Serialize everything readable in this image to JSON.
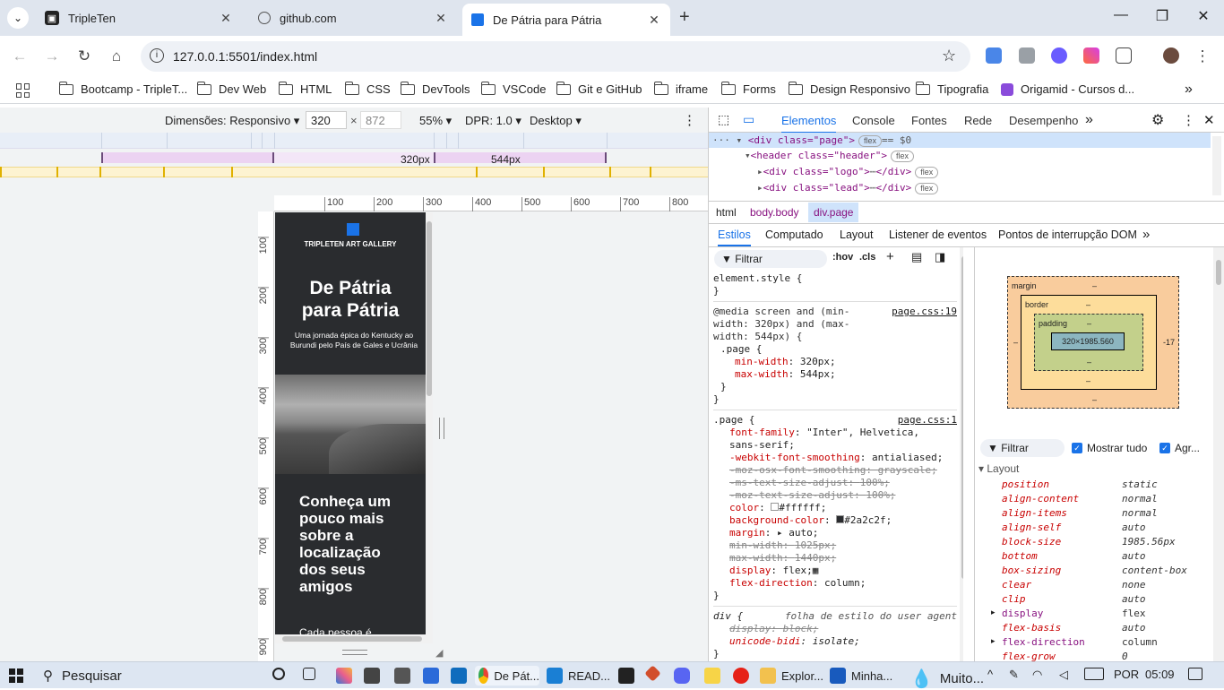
{
  "tabs": [
    {
      "title": "TripleTen",
      "icon": "tripleten-icon"
    },
    {
      "title": "github.com",
      "icon": "globe-icon"
    },
    {
      "title": "De Pátria para Pátria",
      "icon": "page-icon"
    }
  ],
  "address": {
    "url": "127.0.0.1:5501/index.html"
  },
  "bookmarks": [
    "Bootcamp - TripleT...",
    "Dev Web",
    "HTML",
    "CSS",
    "DevTools",
    "VSCode",
    "Git e GitHub",
    "iframe",
    "Forms",
    "Design Responsivo",
    "Tipografia",
    "Origamid - Cursos d..."
  ],
  "device_toolbar": {
    "dimensions": "Dimensões: Responsivo",
    "width": "320",
    "height": "872",
    "zoom": "55%",
    "dpr": "DPR: 1.0",
    "device": "Desktop",
    "x": "×"
  },
  "media_queries": {
    "a": "320px",
    "b": "544px"
  },
  "ruler": {
    "top": [
      "100",
      "200",
      "300",
      "400",
      "500",
      "600",
      "700",
      "800"
    ],
    "left": [
      "100",
      "200",
      "300",
      "400",
      "500",
      "600",
      "700",
      "800",
      "900"
    ]
  },
  "site": {
    "brand": "TRIPLETEN ART GALLERY",
    "title": "De Pátria para Pátria",
    "lead": "Uma jornada épica do Kentucky ao Burundi pelo País de Gales e Ucrânia",
    "section_title": "Conheça um pouco mais sobre a localização dos seus amigos",
    "body_start": "Cada pessoa é"
  },
  "devtools": {
    "tabs": [
      "Elementos",
      "Console",
      "Fontes",
      "Rede",
      "Desempenho"
    ],
    "dom": {
      "line1_tag": "<div class=\"page\">",
      "line1_badge": "flex",
      "line1_eq": "== $0",
      "line2_tag": "<header class=\"header\">",
      "line2_badge": "flex",
      "line3_tag": "<div class=\"logo\">",
      "line3_end": "</div>",
      "line3_badge": "flex",
      "line4_tag": "<div class=\"lead\">",
      "line4_end": "</div>",
      "line4_badge": "flex"
    },
    "breadcrumb": [
      "html",
      "body.body",
      "div.page"
    ],
    "subtabs": [
      "Estilos",
      "Computado",
      "Layout",
      "Listener de eventos",
      "Pontos de interrupção DOM"
    ],
    "filter": "Filtrar",
    "hov": ":hov",
    "cls": ".cls",
    "styles": {
      "element_style": "element.style {",
      "close": "}",
      "media": "@media screen and (min-width: 320px) and (max-width: 544px) {",
      "media_link": "page.css:19",
      "rule1_sel": ".page {",
      "rule1": [
        [
          "min-width",
          "320px;"
        ],
        [
          "max-width",
          "544px;"
        ]
      ],
      "rule2_sel": ".page {",
      "rule2_link": "page.css:1",
      "rule2": [
        [
          "font-family",
          "\"Inter\", Helvetica, sans-serif;"
        ],
        [
          "-webkit-font-smoothing",
          "antialiased;"
        ],
        [
          "-moz-osx-font-smoothing",
          "grayscale;"
        ],
        [
          "-ms-text-size-adjust",
          "100%;"
        ],
        [
          "-moz-text-size-adjust",
          "100%;"
        ],
        [
          "color",
          "#ffffff;"
        ],
        [
          "background-color",
          "#2a2c2f;"
        ],
        [
          "margin",
          "auto;"
        ],
        [
          "min-width",
          "1025px;"
        ],
        [
          "max-width",
          "1440px;"
        ],
        [
          "display",
          "flex;"
        ],
        [
          "flex-direction",
          "column;"
        ]
      ],
      "ua_sel": "div {",
      "ua_note": "folha de estilo do user agent",
      "ua": [
        [
          "display",
          "block;"
        ],
        [
          "unicode-bidi",
          "isolate;"
        ]
      ]
    },
    "boxmodel": {
      "margin": "margin",
      "border": "border",
      "padding": "padding",
      "content": "320×1985.560",
      "dash": "–",
      "right": "-17"
    },
    "computed_filter": "Filtrar",
    "show_all": "Mostrar tudo",
    "group": "Agr...",
    "layout_header": "Layout",
    "computed": [
      [
        "position",
        "static"
      ],
      [
        "align-content",
        "normal"
      ],
      [
        "align-items",
        "normal"
      ],
      [
        "align-self",
        "auto"
      ],
      [
        "block-size",
        "1985.56px"
      ],
      [
        "bottom",
        "auto"
      ],
      [
        "box-sizing",
        "content-box"
      ],
      [
        "clear",
        "none"
      ],
      [
        "clip",
        "auto"
      ],
      [
        "display",
        "flex"
      ],
      [
        "flex-basis",
        "auto"
      ],
      [
        "flex-direction",
        "column"
      ],
      [
        "flex-grow",
        "0"
      ]
    ]
  },
  "taskbar": {
    "search": "Pesquisar",
    "apps": [
      "De Pát...",
      "READ...",
      "Explor...",
      "Minha..."
    ],
    "weather": "Muito...",
    "lang": "POR",
    "time": "05:09"
  },
  "colors": {
    "page_bg": "#2a2c2f",
    "accent": "#1a73e8"
  }
}
